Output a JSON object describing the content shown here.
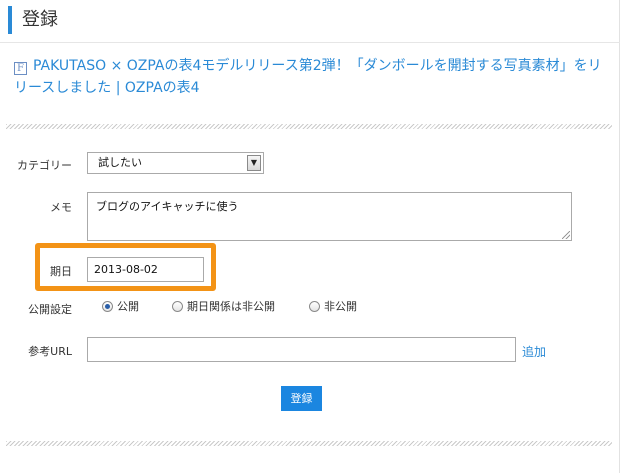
{
  "page": {
    "title": "登録",
    "notice_link": "PAKUTASO × OZPAの表4モデルリリース第2弾！「ダンボールを開封する写真素材」をリリースしました | OZPAの表4"
  },
  "form": {
    "category": {
      "label": "カテゴリー",
      "value": "試したい"
    },
    "memo": {
      "label": "メモ",
      "value": "ブログのアイキャッチに使う"
    },
    "date": {
      "label": "期日",
      "value": "2013-08-02"
    },
    "visibility": {
      "label": "公開設定",
      "options": [
        {
          "label": "公開",
          "selected": true
        },
        {
          "label": "期日関係は非公開",
          "selected": false
        },
        {
          "label": "非公開",
          "selected": false
        }
      ]
    },
    "reference_url": {
      "label": "参考URL",
      "value": "",
      "add_label": "追加"
    },
    "submit_label": "登録"
  },
  "colors": {
    "accent": "#2a8ad6",
    "highlight": "#f39316",
    "button": "#1b86e0"
  },
  "icons": {
    "notice": "facebook-f-icon"
  }
}
